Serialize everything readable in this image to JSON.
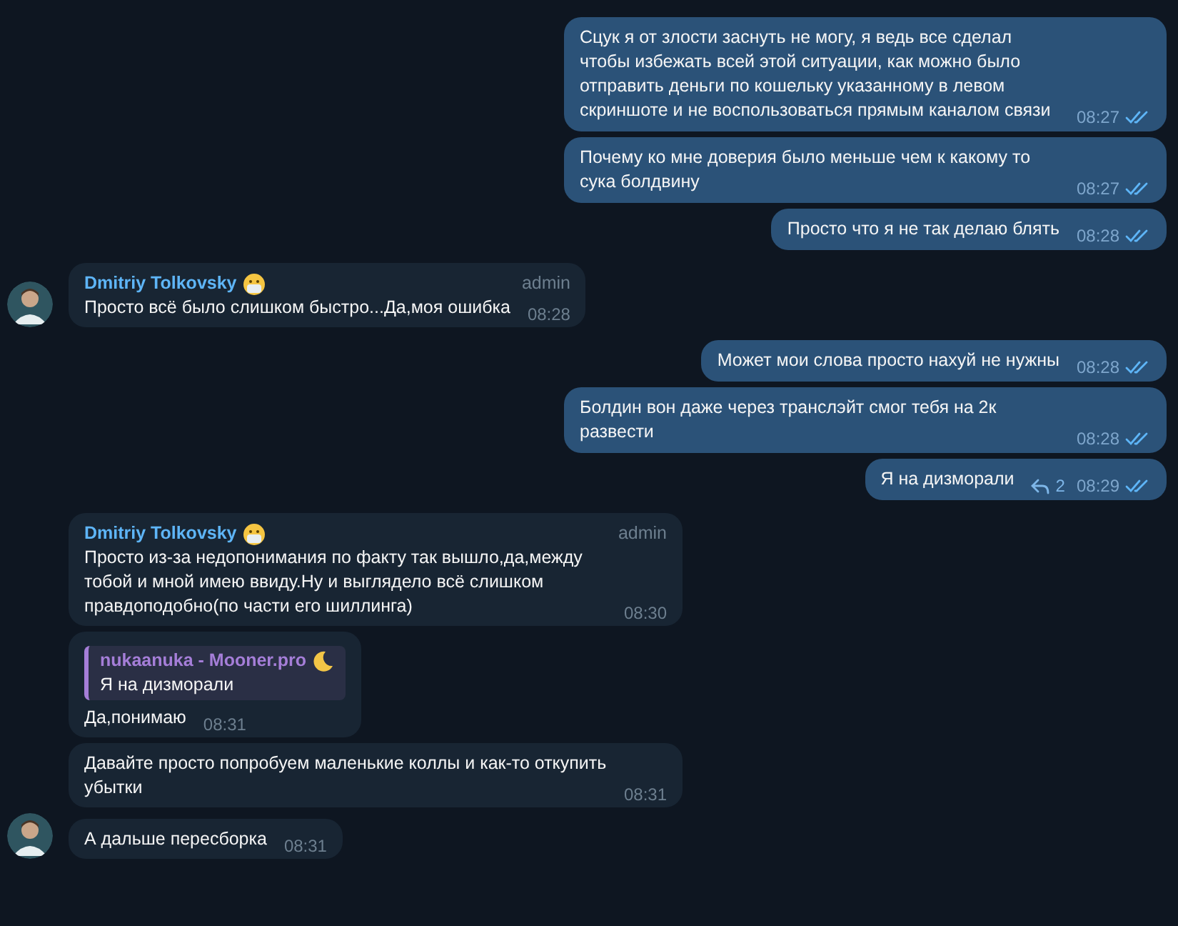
{
  "messages": [
    {
      "kind": "outgoing",
      "text": "Сцук я от злости заснуть не могу, я ведь все сделал чтобы избежать всей этой ситуации, как можно было отправить деньги по кошельку указанному в левом скриншоте и не воспользоваться прямым каналом связи",
      "time": "08:27",
      "read": true
    },
    {
      "kind": "outgoing",
      "text": "Почему ко мне доверия было меньше чем к какому то сука болдвину",
      "time": "08:27",
      "read": true
    },
    {
      "kind": "outgoing",
      "text": "Просто что я не так делаю блять",
      "time": "08:28",
      "read": true
    },
    {
      "kind": "incoming",
      "sender": "Dmitriy Tolkovsky",
      "role": "admin",
      "text": "Просто всё было слишком быстро...Да,моя ошибка",
      "time": "08:28",
      "avatar": true
    },
    {
      "kind": "outgoing",
      "text": "Может мои слова просто нахуй не нужны",
      "time": "08:28",
      "read": true
    },
    {
      "kind": "outgoing",
      "text": "Болдин вон даже через транслэйт смог тебя на 2к развести",
      "time": "08:28",
      "read": true
    },
    {
      "kind": "outgoing",
      "text": "Я на дизморали",
      "time": "08:29",
      "read": true,
      "replies": "2"
    },
    {
      "kind": "incoming",
      "sender": "Dmitriy Tolkovsky",
      "role": "admin",
      "text": "Просто из-за недопонимания по факту так вышло,да,между тобой и мной имею ввиду.Ну и выглядело всё слишком правдоподобно(по части его шиллинга)",
      "time": "08:30",
      "avatar": false
    },
    {
      "kind": "incoming",
      "reply": {
        "author": "nukaanuka - Mooner.pro",
        "text": "Я на дизморали"
      },
      "text": "Да,понимаю",
      "time": "08:31",
      "avatar": false
    },
    {
      "kind": "incoming",
      "text": "Давайте просто попробуем маленькие коллы и как-то откупить убытки",
      "time": "08:31",
      "avatar": false
    },
    {
      "kind": "incoming",
      "text": "А дальше пересборка",
      "time": "08:31",
      "avatar": true
    }
  ]
}
